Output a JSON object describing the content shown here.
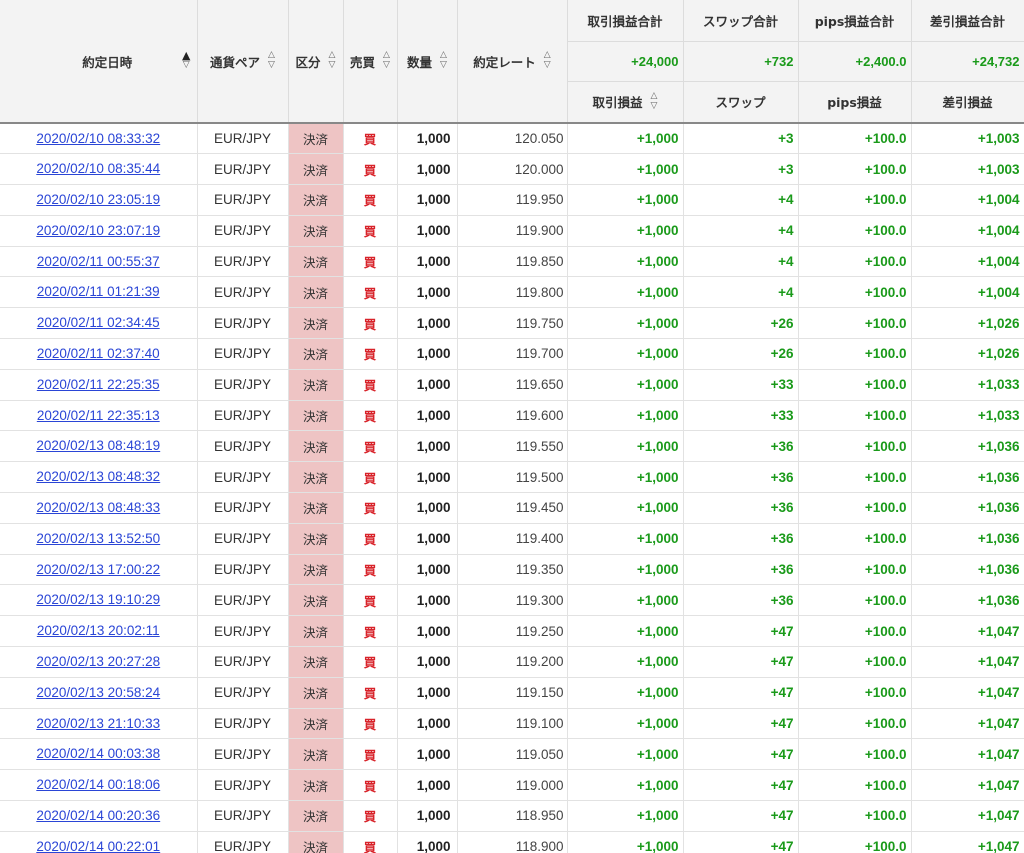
{
  "headers": {
    "date": "約定日時",
    "pair": "通貨ペア",
    "kubun": "区分",
    "side": "売買",
    "qty": "数量",
    "rate": "約定レート",
    "pl_total": "取引損益合計",
    "swap_total": "スワップ合計",
    "pips_total": "pips損益合計",
    "net_total": "差引損益合計",
    "pl": "取引損益",
    "swap": "スワップ",
    "pips": "pips損益",
    "net": "差引損益"
  },
  "totals": {
    "pl": "+24,000",
    "swap": "+732",
    "pips": "+2,400.0",
    "net": "+24,732"
  },
  "sort_icons": {
    "up": "▲",
    "up_hollow": "△",
    "down_hollow": "▽"
  },
  "rows": [
    {
      "date": "2020/02/10 08:33:32",
      "pair": "EUR/JPY",
      "kubun": "決済",
      "side": "買",
      "qty": "1,000",
      "rate": "120.050",
      "pl": "+1,000",
      "swap": "+3",
      "pips": "+100.0",
      "net": "+1,003"
    },
    {
      "date": "2020/02/10 08:35:44",
      "pair": "EUR/JPY",
      "kubun": "決済",
      "side": "買",
      "qty": "1,000",
      "rate": "120.000",
      "pl": "+1,000",
      "swap": "+3",
      "pips": "+100.0",
      "net": "+1,003"
    },
    {
      "date": "2020/02/10 23:05:19",
      "pair": "EUR/JPY",
      "kubun": "決済",
      "side": "買",
      "qty": "1,000",
      "rate": "119.950",
      "pl": "+1,000",
      "swap": "+4",
      "pips": "+100.0",
      "net": "+1,004"
    },
    {
      "date": "2020/02/10 23:07:19",
      "pair": "EUR/JPY",
      "kubun": "決済",
      "side": "買",
      "qty": "1,000",
      "rate": "119.900",
      "pl": "+1,000",
      "swap": "+4",
      "pips": "+100.0",
      "net": "+1,004"
    },
    {
      "date": "2020/02/11 00:55:37",
      "pair": "EUR/JPY",
      "kubun": "決済",
      "side": "買",
      "qty": "1,000",
      "rate": "119.850",
      "pl": "+1,000",
      "swap": "+4",
      "pips": "+100.0",
      "net": "+1,004"
    },
    {
      "date": "2020/02/11 01:21:39",
      "pair": "EUR/JPY",
      "kubun": "決済",
      "side": "買",
      "qty": "1,000",
      "rate": "119.800",
      "pl": "+1,000",
      "swap": "+4",
      "pips": "+100.0",
      "net": "+1,004"
    },
    {
      "date": "2020/02/11 02:34:45",
      "pair": "EUR/JPY",
      "kubun": "決済",
      "side": "買",
      "qty": "1,000",
      "rate": "119.750",
      "pl": "+1,000",
      "swap": "+26",
      "pips": "+100.0",
      "net": "+1,026"
    },
    {
      "date": "2020/02/11 02:37:40",
      "pair": "EUR/JPY",
      "kubun": "決済",
      "side": "買",
      "qty": "1,000",
      "rate": "119.700",
      "pl": "+1,000",
      "swap": "+26",
      "pips": "+100.0",
      "net": "+1,026"
    },
    {
      "date": "2020/02/11 22:25:35",
      "pair": "EUR/JPY",
      "kubun": "決済",
      "side": "買",
      "qty": "1,000",
      "rate": "119.650",
      "pl": "+1,000",
      "swap": "+33",
      "pips": "+100.0",
      "net": "+1,033"
    },
    {
      "date": "2020/02/11 22:35:13",
      "pair": "EUR/JPY",
      "kubun": "決済",
      "side": "買",
      "qty": "1,000",
      "rate": "119.600",
      "pl": "+1,000",
      "swap": "+33",
      "pips": "+100.0",
      "net": "+1,033"
    },
    {
      "date": "2020/02/13 08:48:19",
      "pair": "EUR/JPY",
      "kubun": "決済",
      "side": "買",
      "qty": "1,000",
      "rate": "119.550",
      "pl": "+1,000",
      "swap": "+36",
      "pips": "+100.0",
      "net": "+1,036"
    },
    {
      "date": "2020/02/13 08:48:32",
      "pair": "EUR/JPY",
      "kubun": "決済",
      "side": "買",
      "qty": "1,000",
      "rate": "119.500",
      "pl": "+1,000",
      "swap": "+36",
      "pips": "+100.0",
      "net": "+1,036"
    },
    {
      "date": "2020/02/13 08:48:33",
      "pair": "EUR/JPY",
      "kubun": "決済",
      "side": "買",
      "qty": "1,000",
      "rate": "119.450",
      "pl": "+1,000",
      "swap": "+36",
      "pips": "+100.0",
      "net": "+1,036"
    },
    {
      "date": "2020/02/13 13:52:50",
      "pair": "EUR/JPY",
      "kubun": "決済",
      "side": "買",
      "qty": "1,000",
      "rate": "119.400",
      "pl": "+1,000",
      "swap": "+36",
      "pips": "+100.0",
      "net": "+1,036"
    },
    {
      "date": "2020/02/13 17:00:22",
      "pair": "EUR/JPY",
      "kubun": "決済",
      "side": "買",
      "qty": "1,000",
      "rate": "119.350",
      "pl": "+1,000",
      "swap": "+36",
      "pips": "+100.0",
      "net": "+1,036"
    },
    {
      "date": "2020/02/13 19:10:29",
      "pair": "EUR/JPY",
      "kubun": "決済",
      "side": "買",
      "qty": "1,000",
      "rate": "119.300",
      "pl": "+1,000",
      "swap": "+36",
      "pips": "+100.0",
      "net": "+1,036"
    },
    {
      "date": "2020/02/13 20:02:11",
      "pair": "EUR/JPY",
      "kubun": "決済",
      "side": "買",
      "qty": "1,000",
      "rate": "119.250",
      "pl": "+1,000",
      "swap": "+47",
      "pips": "+100.0",
      "net": "+1,047"
    },
    {
      "date": "2020/02/13 20:27:28",
      "pair": "EUR/JPY",
      "kubun": "決済",
      "side": "買",
      "qty": "1,000",
      "rate": "119.200",
      "pl": "+1,000",
      "swap": "+47",
      "pips": "+100.0",
      "net": "+1,047"
    },
    {
      "date": "2020/02/13 20:58:24",
      "pair": "EUR/JPY",
      "kubun": "決済",
      "side": "買",
      "qty": "1,000",
      "rate": "119.150",
      "pl": "+1,000",
      "swap": "+47",
      "pips": "+100.0",
      "net": "+1,047"
    },
    {
      "date": "2020/02/13 21:10:33",
      "pair": "EUR/JPY",
      "kubun": "決済",
      "side": "買",
      "qty": "1,000",
      "rate": "119.100",
      "pl": "+1,000",
      "swap": "+47",
      "pips": "+100.0",
      "net": "+1,047"
    },
    {
      "date": "2020/02/14 00:03:38",
      "pair": "EUR/JPY",
      "kubun": "決済",
      "side": "買",
      "qty": "1,000",
      "rate": "119.050",
      "pl": "+1,000",
      "swap": "+47",
      "pips": "+100.0",
      "net": "+1,047"
    },
    {
      "date": "2020/02/14 00:18:06",
      "pair": "EUR/JPY",
      "kubun": "決済",
      "side": "買",
      "qty": "1,000",
      "rate": "119.000",
      "pl": "+1,000",
      "swap": "+47",
      "pips": "+100.0",
      "net": "+1,047"
    },
    {
      "date": "2020/02/14 00:20:36",
      "pair": "EUR/JPY",
      "kubun": "決済",
      "side": "買",
      "qty": "1,000",
      "rate": "118.950",
      "pl": "+1,000",
      "swap": "+47",
      "pips": "+100.0",
      "net": "+1,047"
    },
    {
      "date": "2020/02/14 00:22:01",
      "pair": "EUR/JPY",
      "kubun": "決済",
      "side": "買",
      "qty": "1,000",
      "rate": "118.900",
      "pl": "+1,000",
      "swap": "+47",
      "pips": "+100.0",
      "net": "+1,047"
    }
  ]
}
